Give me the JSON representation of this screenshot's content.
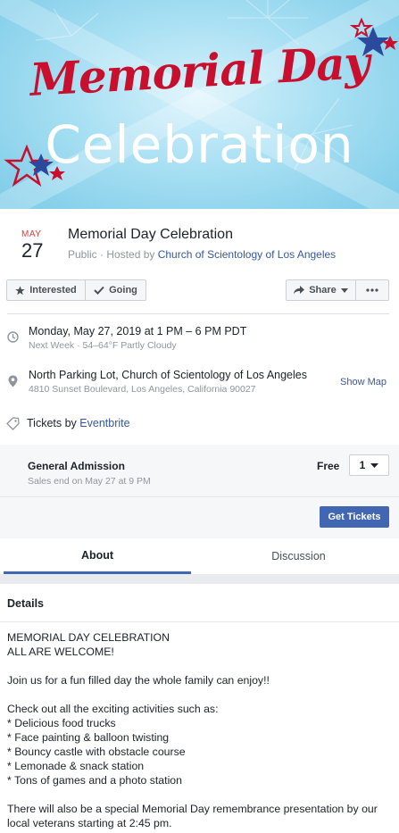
{
  "banner": {
    "title_line1": "Memorial Day",
    "title_line2": "Celebration",
    "colors": {
      "sky": "#a9e0f3",
      "red": "#c8102e",
      "blue": "#2b4a9e"
    }
  },
  "event": {
    "date_month": "MAY",
    "date_day": "27",
    "title": "Memorial Day Celebration",
    "visibility": "Public",
    "hosted_prefix": " · Hosted by ",
    "host": "Church of Scientology of Los Angeles"
  },
  "actions": {
    "interested": "Interested",
    "going": "Going",
    "share": "Share",
    "more_icon": "more-icon"
  },
  "info": {
    "datetime": "Monday, May 27, 2019 at 1 PM – 6 PM PDT",
    "datetime_sub": "Next Week · 54–64°F Partly Cloudy",
    "location": "North Parking Lot, Church of Scientology of Los Angeles",
    "address": "4810 Sunset Boulevard, Los Angeles, California 90027",
    "show_map": "Show Map",
    "tickets_prefix": "Tickets by ",
    "tickets_vendor": "Eventbrite"
  },
  "admission": {
    "name": "General Admission",
    "sales_end": "Sales end on May 27 at 9 PM",
    "price": "Free",
    "quantity": "1",
    "get_tickets": "Get Tickets"
  },
  "tabs": [
    "About",
    "Discussion"
  ],
  "details": {
    "heading": "Details",
    "lines": [
      "MEMORIAL DAY CELEBRATION",
      "ALL ARE WELCOME!",
      "",
      "Join us for a fun filled day the whole family can enjoy!!",
      "",
      "Check out all the exciting activities such as:",
      "* Delicious food trucks",
      "* Face painting & balloon twisting",
      "* Bouncy castle with obstacle course",
      "* Lemonade & snack station",
      "* Tons of games and a photo station",
      "",
      "There will also be a special Memorial Day remembrance presentation by our",
      "local veterans starting at 2:45 pm."
    ]
  }
}
